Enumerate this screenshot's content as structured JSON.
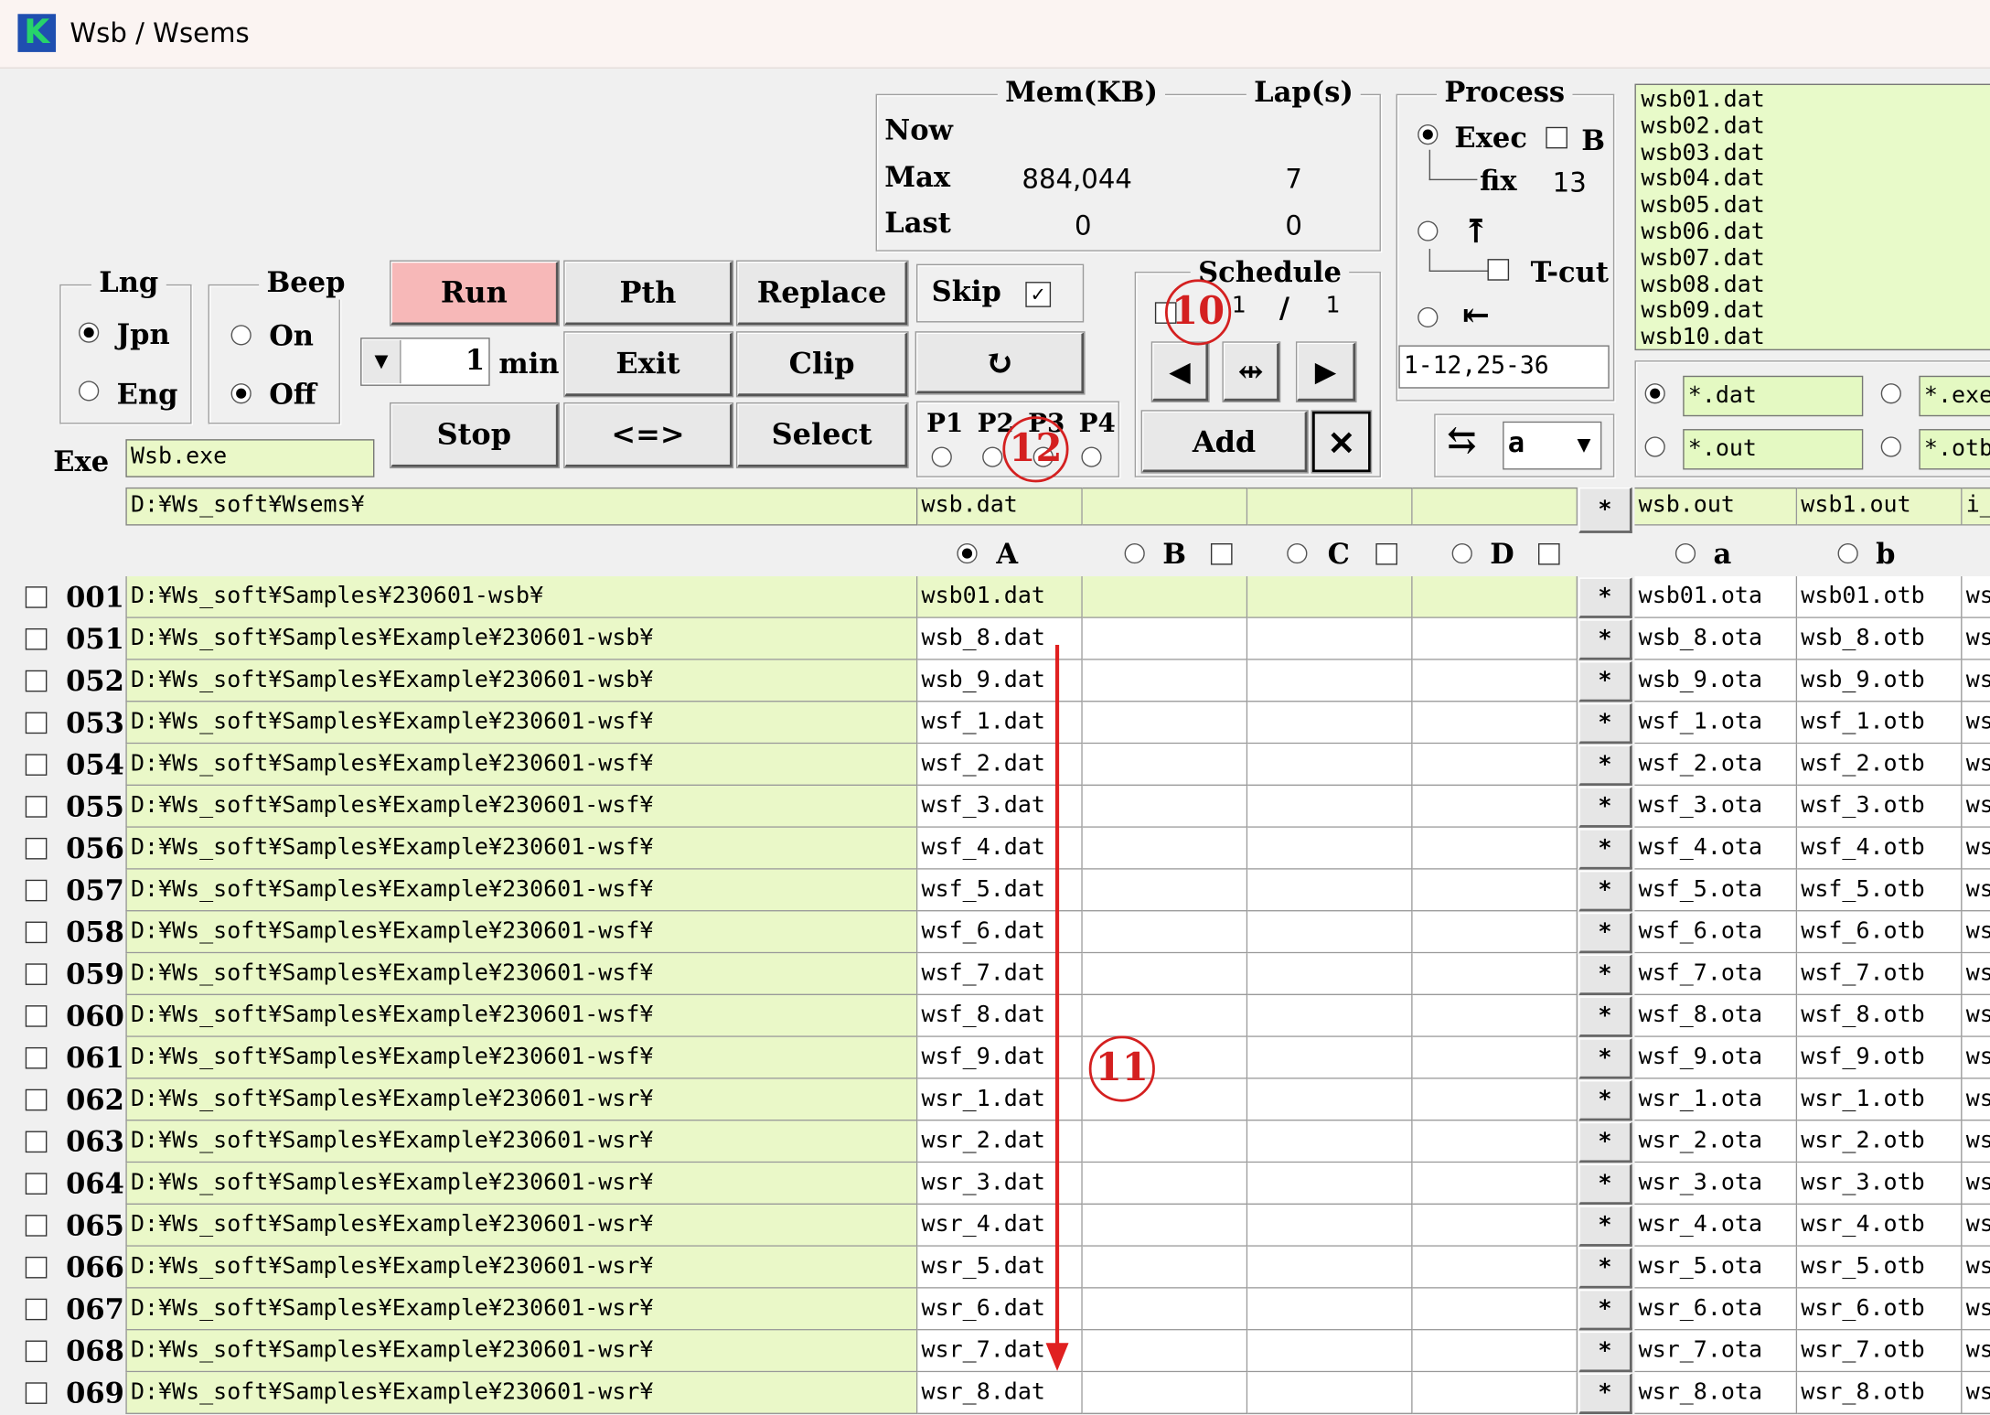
{
  "window": {
    "title": "Wsb / Wsems"
  },
  "mem": {
    "header": "Mem(KB)",
    "lap_header": "Lap(s)",
    "rows": [
      {
        "label": "Now",
        "mem": "",
        "lap": ""
      },
      {
        "label": "Max",
        "mem": "884,044",
        "lap": "7"
      },
      {
        "label": "Last",
        "mem": "0",
        "lap": "0"
      }
    ]
  },
  "process": {
    "title": "Process",
    "exec_label": "Exec",
    "b_label": "B",
    "fix_label": "fix",
    "fix_value": "13",
    "top_icon": "⤒",
    "tcut_label": "T-cut",
    "left_icon": "⇤",
    "range": "1-12,25-36"
  },
  "files": [
    "wsb01.dat",
    "wsb02.dat",
    "wsb03.dat",
    "wsb04.dat",
    "wsb05.dat",
    "wsb06.dat",
    "wsb07.dat",
    "wsb08.dat",
    "wsb09.dat",
    "wsb10.dat"
  ],
  "lng": {
    "title": "Lng",
    "options": [
      "Jpn",
      "Eng"
    ]
  },
  "beep": {
    "title": "Beep",
    "options": [
      "On",
      "Off"
    ]
  },
  "buttons": {
    "run": "Run",
    "pth": "Pth",
    "replace": "Replace",
    "exit": "Exit",
    "clip": "Clip",
    "stop": "Stop",
    "swap": "<=>",
    "select": "Select",
    "add": "Add",
    "close": "✕",
    "refresh": "↻",
    "prev": "◀",
    "center": "⇹",
    "next": "▶",
    "swap_icon": "⇆"
  },
  "timer": {
    "value": "1",
    "unit": "min"
  },
  "skip": {
    "label": "Skip",
    "mark": "✓"
  },
  "priority": {
    "labels": [
      "P1",
      "P2",
      "P3",
      "P4"
    ]
  },
  "schedule": {
    "title": "Schedule",
    "num1": "1",
    "sep": "/",
    "num2": "1"
  },
  "filters": {
    "f1": "*.dat",
    "f2": "*.exe",
    "f3": "*.out",
    "f4": "*.otb"
  },
  "dropdown": {
    "value": "a"
  },
  "exe": {
    "label": "Exe",
    "value": "Wsb.exe"
  },
  "path_row": {
    "path": "D:¥Ws_soft¥Wsems¥",
    "file": "wsb.dat",
    "out_a": "wsb.out",
    "out_b": "wsb1.out",
    "out_c": "i_x"
  },
  "columns": {
    "a": "A",
    "b": "B",
    "c": "C",
    "d": "D",
    "oa": "a",
    "ob": "b"
  },
  "star": "*",
  "markers": {
    "m10": "10",
    "m11": "11",
    "m12": "12"
  },
  "rows": [
    {
      "num": "001",
      "path": "D:¥Ws_soft¥Samples¥230601-wsb¥",
      "file": "wsb01.dat",
      "oa": "wsb01.ota",
      "ob": "wsb01.otb",
      "oc": "ws"
    },
    {
      "num": "051",
      "path": "D:¥Ws_soft¥Samples¥Example¥230601-wsb¥",
      "file": "wsb_8.dat",
      "oa": "wsb_8.ota",
      "ob": "wsb_8.otb",
      "oc": "ws"
    },
    {
      "num": "052",
      "path": "D:¥Ws_soft¥Samples¥Example¥230601-wsb¥",
      "file": "wsb_9.dat",
      "oa": "wsb_9.ota",
      "ob": "wsb_9.otb",
      "oc": "ws"
    },
    {
      "num": "053",
      "path": "D:¥Ws_soft¥Samples¥Example¥230601-wsf¥",
      "file": "wsf_1.dat",
      "oa": "wsf_1.ota",
      "ob": "wsf_1.otb",
      "oc": "ws"
    },
    {
      "num": "054",
      "path": "D:¥Ws_soft¥Samples¥Example¥230601-wsf¥",
      "file": "wsf_2.dat",
      "oa": "wsf_2.ota",
      "ob": "wsf_2.otb",
      "oc": "ws"
    },
    {
      "num": "055",
      "path": "D:¥Ws_soft¥Samples¥Example¥230601-wsf¥",
      "file": "wsf_3.dat",
      "oa": "wsf_3.ota",
      "ob": "wsf_3.otb",
      "oc": "ws"
    },
    {
      "num": "056",
      "path": "D:¥Ws_soft¥Samples¥Example¥230601-wsf¥",
      "file": "wsf_4.dat",
      "oa": "wsf_4.ota",
      "ob": "wsf_4.otb",
      "oc": "ws"
    },
    {
      "num": "057",
      "path": "D:¥Ws_soft¥Samples¥Example¥230601-wsf¥",
      "file": "wsf_5.dat",
      "oa": "wsf_5.ota",
      "ob": "wsf_5.otb",
      "oc": "ws"
    },
    {
      "num": "058",
      "path": "D:¥Ws_soft¥Samples¥Example¥230601-wsf¥",
      "file": "wsf_6.dat",
      "oa": "wsf_6.ota",
      "ob": "wsf_6.otb",
      "oc": "ws"
    },
    {
      "num": "059",
      "path": "D:¥Ws_soft¥Samples¥Example¥230601-wsf¥",
      "file": "wsf_7.dat",
      "oa": "wsf_7.ota",
      "ob": "wsf_7.otb",
      "oc": "ws"
    },
    {
      "num": "060",
      "path": "D:¥Ws_soft¥Samples¥Example¥230601-wsf¥",
      "file": "wsf_8.dat",
      "oa": "wsf_8.ota",
      "ob": "wsf_8.otb",
      "oc": "ws"
    },
    {
      "num": "061",
      "path": "D:¥Ws_soft¥Samples¥Example¥230601-wsf¥",
      "file": "wsf_9.dat",
      "oa": "wsf_9.ota",
      "ob": "wsf_9.otb",
      "oc": "ws"
    },
    {
      "num": "062",
      "path": "D:¥Ws_soft¥Samples¥Example¥230601-wsr¥",
      "file": "wsr_1.dat",
      "oa": "wsr_1.ota",
      "ob": "wsr_1.otb",
      "oc": "ws"
    },
    {
      "num": "063",
      "path": "D:¥Ws_soft¥Samples¥Example¥230601-wsr¥",
      "file": "wsr_2.dat",
      "oa": "wsr_2.ota",
      "ob": "wsr_2.otb",
      "oc": "ws"
    },
    {
      "num": "064",
      "path": "D:¥Ws_soft¥Samples¥Example¥230601-wsr¥",
      "file": "wsr_3.dat",
      "oa": "wsr_3.ota",
      "ob": "wsr_3.otb",
      "oc": "ws"
    },
    {
      "num": "065",
      "path": "D:¥Ws_soft¥Samples¥Example¥230601-wsr¥",
      "file": "wsr_4.dat",
      "oa": "wsr_4.ota",
      "ob": "wsr_4.otb",
      "oc": "ws"
    },
    {
      "num": "066",
      "path": "D:¥Ws_soft¥Samples¥Example¥230601-wsr¥",
      "file": "wsr_5.dat",
      "oa": "wsr_5.ota",
      "ob": "wsr_5.otb",
      "oc": "ws"
    },
    {
      "num": "067",
      "path": "D:¥Ws_soft¥Samples¥Example¥230601-wsr¥",
      "file": "wsr_6.dat",
      "oa": "wsr_6.ota",
      "ob": "wsr_6.otb",
      "oc": "ws"
    },
    {
      "num": "068",
      "path": "D:¥Ws_soft¥Samples¥Example¥230601-wsr¥",
      "file": "wsr_7.dat",
      "oa": "wsr_7.ota",
      "ob": "wsr_7.otb",
      "oc": "ws"
    },
    {
      "num": "069",
      "path": "D:¥Ws_soft¥Samples¥Example¥230601-wsr¥",
      "file": "wsr_8.dat",
      "oa": "wsr_8.ota",
      "ob": "wsr_8.otb",
      "oc": "ws"
    }
  ]
}
